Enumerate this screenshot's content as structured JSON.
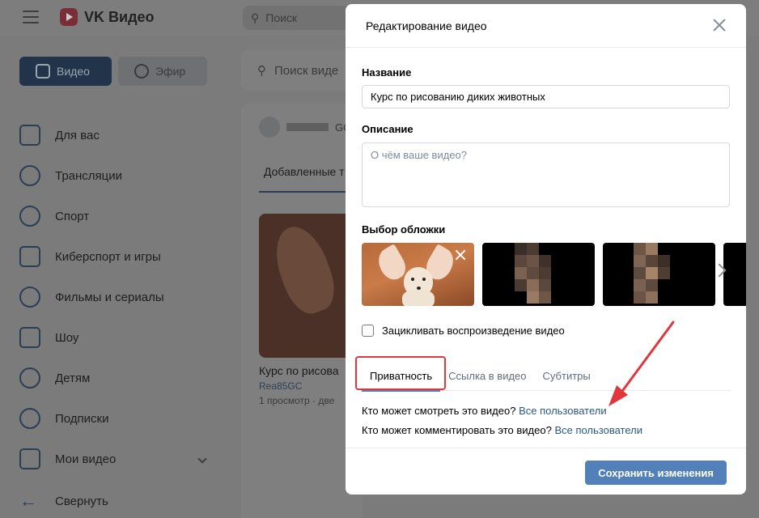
{
  "app": {
    "logo_text": "VK Видео",
    "search_placeholder": "Поиск",
    "tabs": [
      {
        "label": "Видео"
      },
      {
        "label": "Эфир"
      }
    ],
    "sidebar": [
      {
        "label": "Для вас",
        "icon": "thumbs-up-icon"
      },
      {
        "label": "Трансляции",
        "icon": "broadcast-icon"
      },
      {
        "label": "Спорт",
        "icon": "basketball-icon"
      },
      {
        "label": "Киберспорт и игры",
        "icon": "gamepad-icon"
      },
      {
        "label": "Фильмы и сериалы",
        "icon": "film-reel-icon"
      },
      {
        "label": "Шоу",
        "icon": "tv-icon"
      },
      {
        "label": "Детям",
        "icon": "kids-icon"
      },
      {
        "label": "Подписки",
        "icon": "rss-icon"
      },
      {
        "label": "Мои видео",
        "icon": "my-videos-icon"
      }
    ],
    "collapse_label": "Свернуть",
    "content_search_placeholder": "Поиск виде",
    "channel_suffix": "GC",
    "added_tab": "Добавленные т",
    "video_card": {
      "title": "Курс по рисова",
      "author": "Rea85GC",
      "stats": "1 просмотр · две"
    }
  },
  "modal": {
    "title": "Редактирование видео",
    "name_label": "Название",
    "name_value": "Курс по рисованию диких животных",
    "desc_label": "Описание",
    "desc_placeholder": "О чём ваше видео?",
    "cover_label": "Выбор обложки",
    "loop_label": "Зацикливать воспроизведение видео",
    "loop_checked": false,
    "tabs": [
      {
        "label": "Приватность",
        "active": true
      },
      {
        "label": "Ссылка в видео",
        "active": false
      },
      {
        "label": "Субтитры",
        "active": false
      }
    ],
    "privacy": {
      "view_question": "Кто может смотреть это видео?",
      "view_value": "Все пользователи",
      "comment_question": "Кто может комментировать это видео?",
      "comment_value": "Все пользователи"
    },
    "save_label": "Сохранить изменения"
  },
  "colors": {
    "accent": "#5181b8",
    "link": "#2a5885",
    "annotation": "#e0363c"
  }
}
